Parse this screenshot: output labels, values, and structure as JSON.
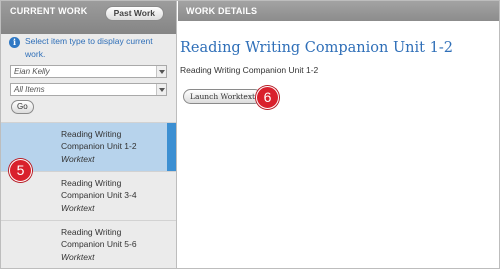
{
  "left_panel": {
    "title": "CURRENT WORK",
    "past_work_label": "Past Work",
    "info_icon": "info-icon",
    "info_text": "Select item type to display current work.",
    "student_select": {
      "value": "Eian Kelly"
    },
    "type_select": {
      "value": "All Items"
    },
    "go_label": "Go",
    "items": [
      {
        "title": "Reading Writing Companion Unit 1-2",
        "type": "Worktext",
        "selected": true
      },
      {
        "title": "Reading Writing Companion Unit 3-4",
        "type": "Worktext",
        "selected": false
      },
      {
        "title": "Reading Writing Companion Unit 5-6",
        "type": "Worktext",
        "selected": false
      }
    ]
  },
  "right_panel": {
    "title": "WORK DETAILS",
    "work_title": "Reading Writing Companion Unit 1-2",
    "work_subtitle": "Reading Writing Companion Unit 1-2",
    "launch_label": "Launch Worktext"
  },
  "callouts": {
    "five": "5",
    "six": "6"
  },
  "colors": {
    "accent_blue": "#2f6fb8",
    "selected_bg": "#b7d3ec",
    "selected_bar": "#3c8fd2",
    "callout_red": "#d9202c"
  }
}
